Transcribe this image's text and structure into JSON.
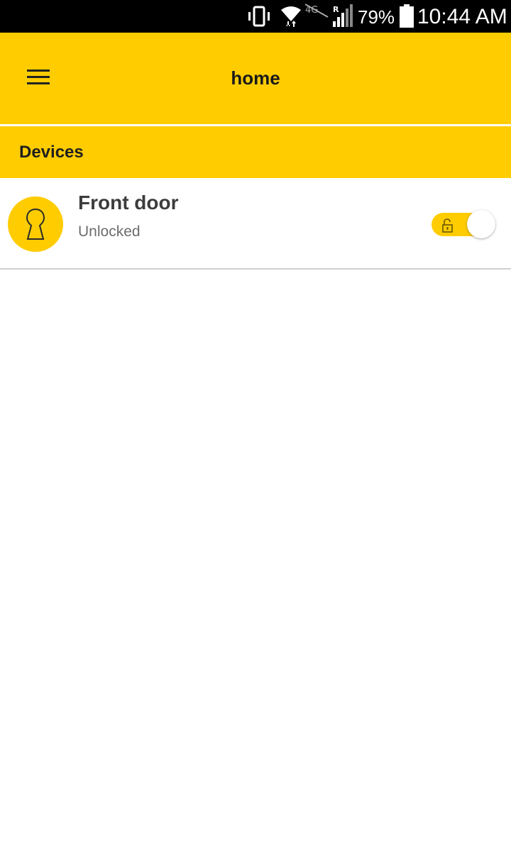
{
  "colors": {
    "accent": "#FFCC00",
    "status_bar": "#000000",
    "background": "#FFFFFF",
    "divider": "#D0D0D0"
  },
  "status_bar": {
    "battery_percent": "79%",
    "time": "10:44 AM",
    "icons": [
      "vibrate-icon",
      "wifi-icon",
      "no-lte-icon",
      "signal-roaming-icon",
      "battery-icon"
    ]
  },
  "app_bar": {
    "title": "home",
    "menu_icon": "hamburger-menu-icon"
  },
  "section": {
    "title": "Devices"
  },
  "devices": [
    {
      "name": "Front door",
      "status": "Unlocked",
      "icon": "keyhole-icon",
      "toggle_icon": "unlocked-padlock-icon"
    }
  ]
}
